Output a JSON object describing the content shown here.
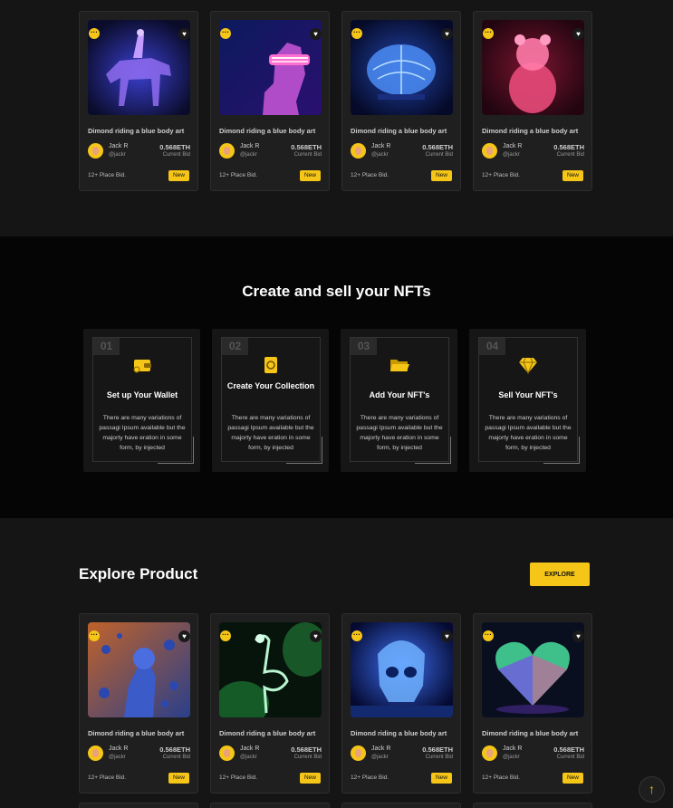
{
  "top_cards": [
    {
      "title": "Dimond riding a blue body art",
      "user_name": "Jack R",
      "user_handle": "@jackr",
      "price": "0.568ETH",
      "bid_label": "Current Bid",
      "place": "12+ Place Bid.",
      "badge": "New",
      "art_theme": "rider"
    },
    {
      "title": "Dimond riding a blue body art",
      "user_name": "Jack R",
      "user_handle": "@jackr",
      "price": "0.568ETH",
      "bid_label": "Current Bid",
      "place": "12+ Place Bid.",
      "badge": "New",
      "art_theme": "vr-face"
    },
    {
      "title": "Dimond riding a blue body art",
      "user_name": "Jack R",
      "user_handle": "@jackr",
      "price": "0.568ETH",
      "bid_label": "Current Bid",
      "place": "12+ Place Bid.",
      "badge": "New",
      "art_theme": "brain"
    },
    {
      "title": "Dimond riding a blue body art",
      "user_name": "Jack R",
      "user_handle": "@jackr",
      "price": "0.568ETH",
      "bid_label": "Current Bid",
      "place": "12+ Place Bid.",
      "badge": "New",
      "art_theme": "crystal-bear"
    }
  ],
  "steps_section": {
    "title": "Create and sell your NFTs",
    "steps": [
      {
        "number": "01",
        "title": "Set up Your Wallet",
        "description": "There are many variations of passagi Ipsum available but the majorty have eration in some form, by injected",
        "icon": "wallet-icon"
      },
      {
        "number": "02",
        "title": "Create Your Collection",
        "description": "There are many variations of passagi Ipsum available but the majorty have eration in some form, by injected",
        "icon": "collection-icon"
      },
      {
        "number": "03",
        "title": "Add Your NFT's",
        "description": "There are many variations of passagi Ipsum available but the majorty have eration in some form, by injected",
        "icon": "folder-icon"
      },
      {
        "number": "04",
        "title": "Sell Your NFT's",
        "description": "There are many variations of passagi Ipsum available but the majorty have eration in some form, by injected",
        "icon": "diamond-icon"
      }
    ]
  },
  "explore_section": {
    "title": "Explore Product",
    "button_label": "EXPLORE",
    "cards": [
      {
        "title": "Dimond riding a blue body art",
        "user_name": "Jack R",
        "user_handle": "@jackr",
        "price": "0.568ETH",
        "bid_label": "Current Bid",
        "place": "12+ Place Bid.",
        "badge": "New",
        "art_theme": "bubbles"
      },
      {
        "title": "Dimond riding a blue body art",
        "user_name": "Jack R",
        "user_handle": "@jackr",
        "price": "0.568ETH",
        "bid_label": "Current Bid",
        "place": "12+ Place Bid.",
        "badge": "New",
        "art_theme": "flamingo"
      },
      {
        "title": "Dimond riding a blue body art",
        "user_name": "Jack R",
        "user_handle": "@jackr",
        "price": "0.568ETH",
        "bid_label": "Current Bid",
        "place": "12+ Place Bid.",
        "badge": "New",
        "art_theme": "crystal-skull"
      },
      {
        "title": "Dimond riding a blue body art",
        "user_name": "Jack R",
        "user_handle": "@jackr",
        "price": "0.568ETH",
        "bid_label": "Current Bid",
        "place": "12+ Place Bid.",
        "badge": "New",
        "art_theme": "heart"
      }
    ]
  },
  "colors": {
    "accent": "#f5c518",
    "card_bg": "#1f1f1f",
    "page_bg": "#151515",
    "steps_bg": "#050505"
  }
}
